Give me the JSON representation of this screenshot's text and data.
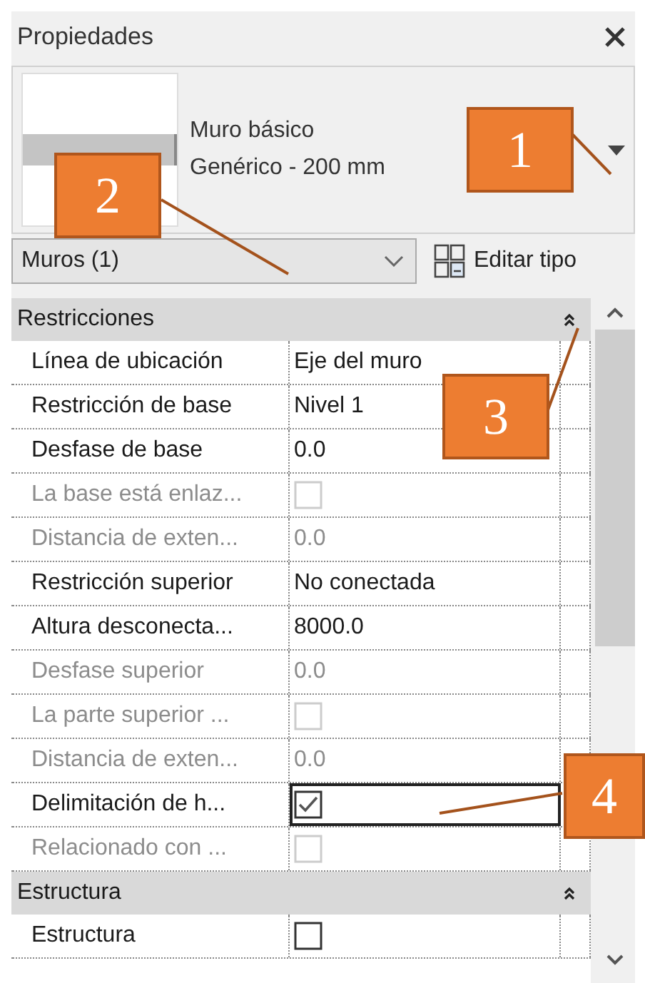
{
  "panel": {
    "title": "Propiedades"
  },
  "type_selector": {
    "family": "Muro básico",
    "type": "Genérico - 200 mm"
  },
  "filter": {
    "value": "Muros (1)"
  },
  "edit_type_button": {
    "label": "Editar tipo"
  },
  "sections": [
    {
      "title": "Restricciones",
      "expanded": true,
      "rows": [
        {
          "kind": "text",
          "label": "Línea de ubicación",
          "value": "Eje del muro",
          "disabled": false,
          "selected": false
        },
        {
          "kind": "text",
          "label": "Restricción de base",
          "value": "Nivel 1",
          "disabled": false,
          "selected": false
        },
        {
          "kind": "text",
          "label": "Desfase de base",
          "value": "0.0",
          "disabled": false,
          "selected": false
        },
        {
          "kind": "checkbox",
          "label": "La base está enlaz...",
          "checked": false,
          "disabled": true,
          "selected": false
        },
        {
          "kind": "text",
          "label": "Distancia de exten...",
          "value": "0.0",
          "disabled": true,
          "selected": false
        },
        {
          "kind": "text",
          "label": "Restricción superior",
          "value": "No conectada",
          "disabled": false,
          "selected": false
        },
        {
          "kind": "text",
          "label": "Altura desconecta...",
          "value": "8000.0",
          "disabled": false,
          "selected": false
        },
        {
          "kind": "text",
          "label": "Desfase superior",
          "value": "0.0",
          "disabled": true,
          "selected": false
        },
        {
          "kind": "checkbox",
          "label": "La parte superior ...",
          "checked": false,
          "disabled": true,
          "selected": false
        },
        {
          "kind": "text",
          "label": "Distancia de exten...",
          "value": "0.0",
          "disabled": true,
          "selected": false
        },
        {
          "kind": "checkbox",
          "label": "Delimitación de h...",
          "checked": true,
          "disabled": false,
          "selected": true
        },
        {
          "kind": "checkbox",
          "label": "Relacionado con ...",
          "checked": false,
          "disabled": true,
          "selected": false
        }
      ]
    },
    {
      "title": "Estructura",
      "expanded": true,
      "rows": [
        {
          "kind": "checkbox",
          "label": "Estructura",
          "checked": false,
          "disabled": false,
          "selected": false
        }
      ]
    }
  ],
  "callouts": [
    {
      "number": "1"
    },
    {
      "number": "2"
    },
    {
      "number": "3"
    },
    {
      "number": "4"
    }
  ]
}
